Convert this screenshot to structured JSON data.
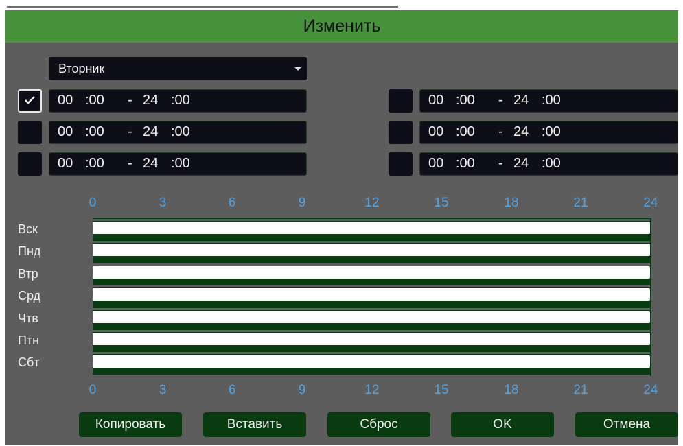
{
  "title": "Изменить",
  "day_select": {
    "value": "Вторник"
  },
  "periods": [
    {
      "checked": true,
      "h1": "00",
      "m1": ":00",
      "dash": "-",
      "h2": "24",
      "m2": ":00"
    },
    {
      "checked": false,
      "h1": "00",
      "m1": ":00",
      "dash": "-",
      "h2": "24",
      "m2": ":00"
    },
    {
      "checked": false,
      "h1": "00",
      "m1": ":00",
      "dash": "-",
      "h2": "24",
      "m2": ":00"
    },
    {
      "checked": false,
      "h1": "00",
      "m1": ":00",
      "dash": "-",
      "h2": "24",
      "m2": ":00"
    },
    {
      "checked": false,
      "h1": "00",
      "m1": ":00",
      "dash": "-",
      "h2": "24",
      "m2": ":00"
    },
    {
      "checked": false,
      "h1": "00",
      "m1": ":00",
      "dash": "-",
      "h2": "24",
      "m2": ":00"
    }
  ],
  "hours": [
    "0",
    "3",
    "6",
    "9",
    "12",
    "15",
    "18",
    "21",
    "24"
  ],
  "days": [
    "Вск",
    "Пнд",
    "Втр",
    "Срд",
    "Чтв",
    "Птн",
    "Сбт"
  ],
  "schedule_full_day": [
    true,
    true,
    true,
    true,
    true,
    true,
    true
  ],
  "buttons": {
    "copy": "Копировать",
    "paste": "Вставить",
    "reset": "Сброс",
    "ok": "OK",
    "cancel": "Отмена"
  },
  "colors": {
    "title_bar": "#48923c",
    "panel": "#5d5d5d",
    "field": "#0e0e18",
    "hour_labels": "#4ea3e6",
    "schedule_fill": "#ffffff",
    "schedule_bg": "#0a3a10"
  }
}
